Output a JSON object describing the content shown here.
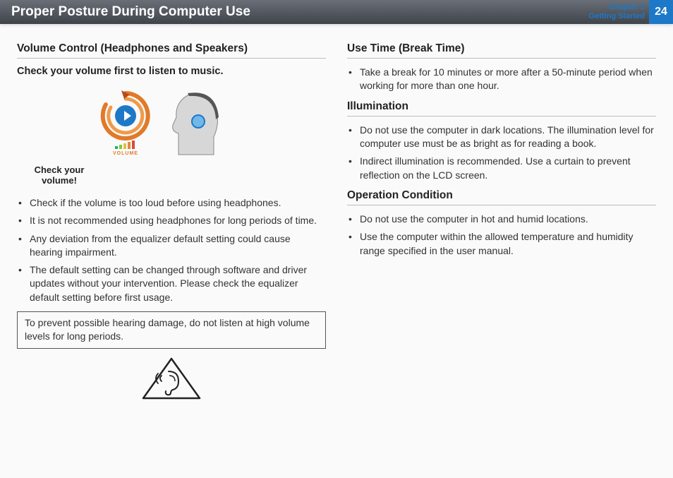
{
  "header": {
    "title": "Proper Posture During Computer Use",
    "chapter_line1": "Chapter 1",
    "chapter_line2": "Getting Started",
    "page_number": "24"
  },
  "left": {
    "section_title": "Volume Control (Headphones and Speakers)",
    "subheading": "Check your volume first to listen to music.",
    "caption_line1": "Check your",
    "caption_line2": "volume!",
    "icon_label": "VOLUME",
    "bullets": [
      "Check if the volume is too loud before using headphones.",
      "It is not recommended using headphones for long periods of time.",
      "Any deviation from the equalizer default setting could cause hearing impairment.",
      "The default setting can be changed through software and driver updates without your intervention. Please check the equalizer default setting before first usage."
    ],
    "warning": "To prevent possible hearing damage, do not listen at high volume levels for long periods."
  },
  "right": {
    "sections": [
      {
        "title": "Use Time (Break Time)",
        "bullets": [
          "Take a break for 10 minutes or more after a 50-minute period when working for more than one hour."
        ]
      },
      {
        "title": "Illumination",
        "bullets": [
          "Do not use the computer in dark locations. The illumination level for computer use must be as bright as for reading a book.",
          "Indirect illumination is recommended. Use a curtain to prevent reflection on the LCD screen."
        ]
      },
      {
        "title": "Operation Condition",
        "bullets": [
          "Do not use the computer in hot and humid locations.",
          "Use the computer within the allowed temperature and humidity range specified in the user manual."
        ]
      }
    ]
  }
}
